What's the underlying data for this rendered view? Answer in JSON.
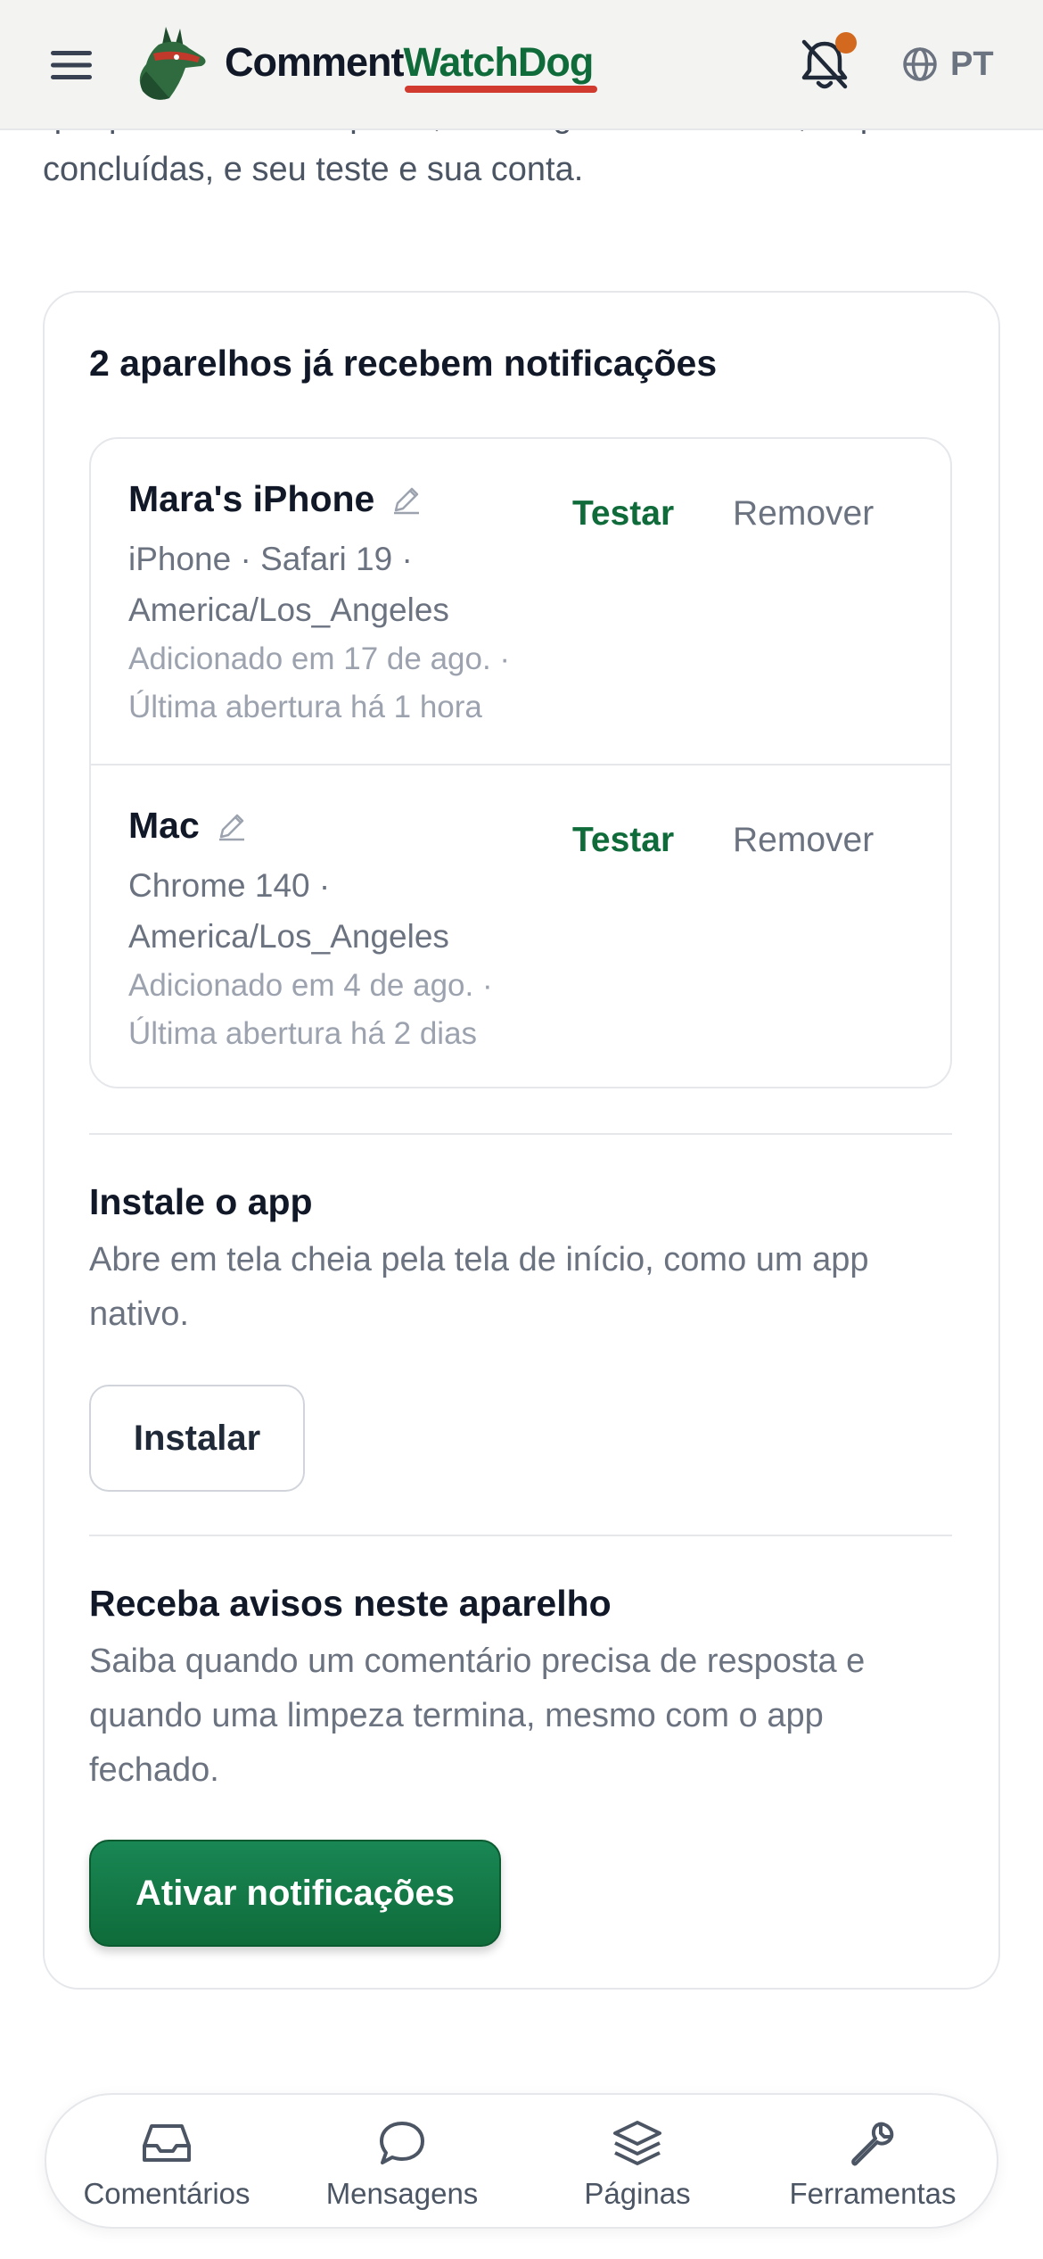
{
  "header": {
    "brand_part1": "Comment",
    "brand_part2": "WatchDog",
    "language": "PT",
    "colors": {
      "brand_green": "#0f6b3a",
      "underline_red": "#d13a2e",
      "notification_dot": "#d2691e"
    }
  },
  "intro": {
    "text": "que precisam de resposta, mensagens de clientes, limpezas concluídas, e seu teste e sua conta."
  },
  "devices": {
    "title": "2 aparelhos já recebem notificações",
    "items": [
      {
        "name": "Mara's iPhone",
        "meta": "iPhone · Safari 19 · America/Los_Angeles",
        "added": "Adicionado em 17 de ago. · Última abertura há 1 hora",
        "test_label": "Testar",
        "remove_label": "Remover"
      },
      {
        "name": "Mac",
        "meta": "Chrome 140 · America/Los_Angeles",
        "added": "Adicionado em 4 de ago. · Última abertura há 2 dias",
        "test_label": "Testar",
        "remove_label": "Remover"
      }
    ]
  },
  "install": {
    "title": "Instale o app",
    "description": "Abre em tela cheia pela tela de início, como um app nativo.",
    "button_label": "Instalar"
  },
  "notifications": {
    "title": "Receba avisos neste aparelho",
    "description": "Saiba quando um comentário precisa de resposta e quando uma limpeza termina, mesmo com o app fechado.",
    "button_label": "Ativar notificações"
  },
  "tabbar": {
    "items": [
      {
        "label": "Comentários",
        "icon": "inbox-icon"
      },
      {
        "label": "Mensagens",
        "icon": "chat-bubble-icon"
      },
      {
        "label": "Páginas",
        "icon": "layers-icon"
      },
      {
        "label": "Ferramentas",
        "icon": "wrench-icon"
      }
    ]
  }
}
